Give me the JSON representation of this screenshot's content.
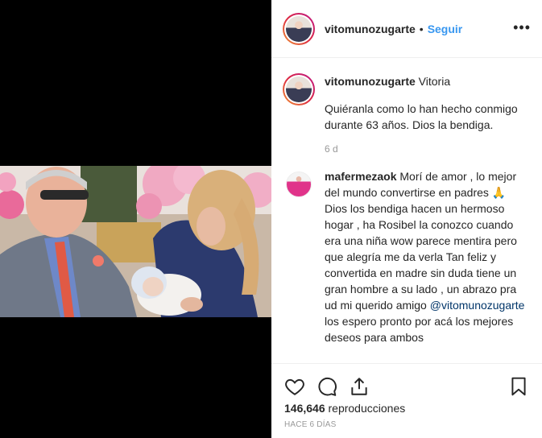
{
  "header": {
    "username": "vitomunozugarte",
    "separator": "•",
    "follow_label": "Seguir",
    "more_icon": "ellipsis-icon"
  },
  "caption": {
    "username": "vitomunozugarte",
    "title": "Vitoria",
    "text": "Quiéranla como lo han hecho conmigo durante 63 años. Dios la bendiga.",
    "time": "6 d"
  },
  "comment": {
    "username": "mafermezaok",
    "text_before": "Morí de amor , lo mejor del mundo convertirse en padres 🙏 Dios los bendiga hacen un hermoso hogar , ha Rosibel la conozco cuando era una niña wow parece mentira pero que alegría me da verla Tan feliz y convertida en madre sin duda tiene un gran hombre a su lado , un abrazo pra ud mi querido amigo ",
    "mention": "@vitomunozugarte",
    "text_after": " los espero pronto por acá los mejores deseos para ambos"
  },
  "actions": {
    "icons": [
      "heart-icon",
      "comment-icon",
      "share-icon",
      "bookmark-icon"
    ],
    "views_count": "146,646",
    "views_label": "reproducciones",
    "posted_ago": "HACE 6 DÍAS"
  }
}
